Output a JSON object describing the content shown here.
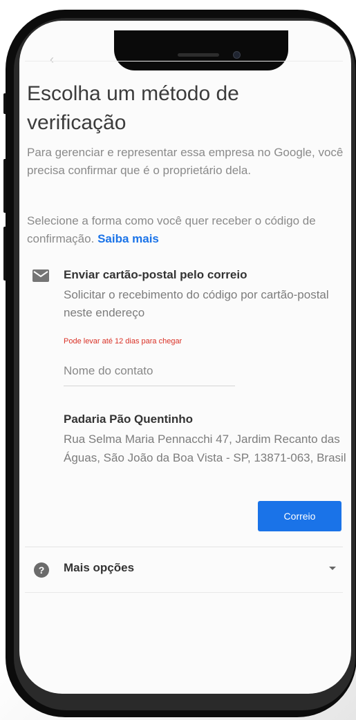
{
  "title": "Escolha um método de verificação",
  "intro": "Para gerenciar e representar essa empresa no Google, você precisa confirmar que é o proprietário dela.",
  "select_text": "Selecione a forma como você quer receber o código de confirmação.",
  "learn_more": "Saiba mais",
  "option": {
    "icon": "mail-icon",
    "title": "Enviar cartão-postal pelo correio",
    "description": "Solicitar o recebimento do código por cartão-postal neste endereço",
    "warning": "Pode levar até 12 dias para chegar",
    "contact_placeholder": "Nome do contato",
    "business_name": "Padaria Pão Quentinho",
    "address": "Rua Selma Maria Pennacchi 47, Jardim Recanto das Águas, São João da Boa Vista - SP, 13871-063, Brasil",
    "button_label": "Correio"
  },
  "more_options": {
    "icon": "help-icon",
    "label": "Mais opções"
  },
  "colors": {
    "accent": "#1a73e8",
    "warning": "#d93025"
  }
}
